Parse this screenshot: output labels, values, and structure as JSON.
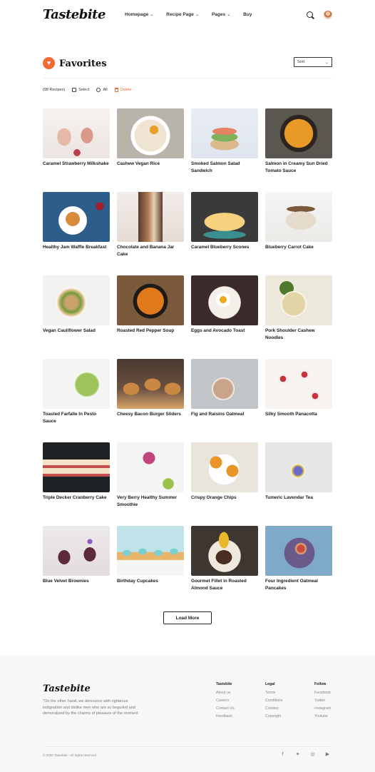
{
  "header": {
    "logo": "Tastebite",
    "nav": [
      {
        "label": "Homepage"
      },
      {
        "label": "Recipe Page"
      },
      {
        "label": "Pages"
      },
      {
        "label": "Buy"
      }
    ]
  },
  "page": {
    "title": "Favorites",
    "sort_label": "Sort",
    "recipe_count": "(98 Recipes)",
    "select_label": "Select",
    "all_label": "All",
    "delete_label": "Delete"
  },
  "recipes": [
    {
      "title": "Caramel Strawberry Milkshake"
    },
    {
      "title": "Cashew Vegan Rice"
    },
    {
      "title": "Smoked Salmon Salad Sandwich"
    },
    {
      "title": "Salmon in Creamy Sun Dried Tomato Sauce"
    },
    {
      "title": "Healthy Jam Waffle Breakfast"
    },
    {
      "title": "Chocolate and Banana Jar Cake"
    },
    {
      "title": "Caramel Blueberry Scones"
    },
    {
      "title": "Blueberry Carrot Cake"
    },
    {
      "title": "Vegan Cauliflower Salad"
    },
    {
      "title": "Roasted Red Pepper Soup"
    },
    {
      "title": "Eggs and Avocado Toast"
    },
    {
      "title": "Pork Shoulder Cashew Noodles"
    },
    {
      "title": "Toasted Farfalle In Pesto Sauce"
    },
    {
      "title": "Cheesy Bacon Burger Sliders"
    },
    {
      "title": "Fig and Raisins Oatmeal"
    },
    {
      "title": "Silky Smooth Panacotta"
    },
    {
      "title": "Triple Decker Cranberry Cake"
    },
    {
      "title": "Very Berry Healthy Summer Smoothie"
    },
    {
      "title": "Crispy Orange Chips"
    },
    {
      "title": "Tumeric Lavendar Tea"
    },
    {
      "title": "Blue Velvet Brownies"
    },
    {
      "title": "Birthday Cupcakes"
    },
    {
      "title": "Gourmet Fillet in Roasted Almond Sauce"
    },
    {
      "title": "Four Ingredient Oatmeal Pancakes"
    }
  ],
  "load_more": "Load More",
  "footer": {
    "logo": "Tastebite",
    "quote": "\"On the other hand, we denounce with righteous indignation and dislike men who are so beguiled and demoralized by the charms of pleasure of the moment",
    "columns": [
      {
        "heading": "Tastebite",
        "links": [
          "About us",
          "Careers",
          "Contact Us",
          "Feedback"
        ]
      },
      {
        "heading": "Legal",
        "links": [
          "Terms",
          "Conditions",
          "Cookies",
          "Copyright"
        ]
      },
      {
        "heading": "Follow",
        "links": [
          "Facebook",
          "Twitter",
          "Instagram",
          "Youtube"
        ]
      }
    ],
    "copyright": "© 2020 Tastebite - All rights reserved"
  },
  "colors": {
    "accent": "#f06a33",
    "footer_bg": "#f7f7f7"
  }
}
